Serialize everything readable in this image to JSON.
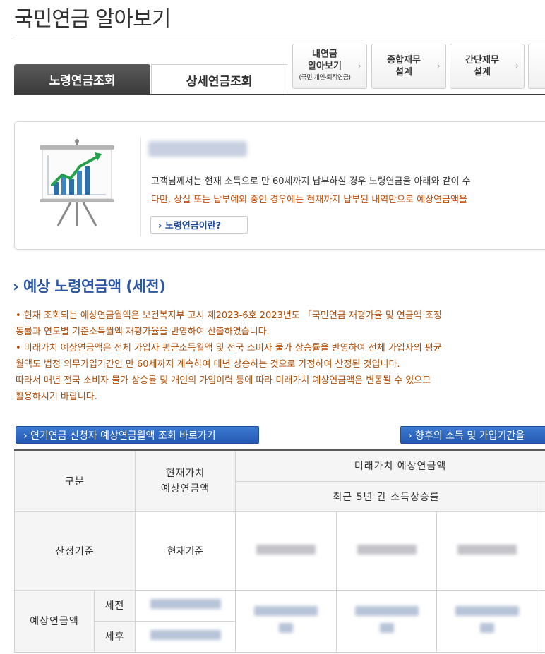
{
  "page": {
    "title": "국민연금 알아보기"
  },
  "tabs": [
    {
      "label": "노령연금조회",
      "active": true
    },
    {
      "label": "상세연금조회",
      "active": false
    }
  ],
  "quick_links": [
    {
      "line1": "내연금",
      "line2": "알아보기",
      "sub": "(국민·개인·퇴직연금)"
    },
    {
      "line1": "종합재무",
      "line2": "설계"
    },
    {
      "line1": "간단재무",
      "line2": "설계"
    }
  ],
  "intro": {
    "icon": "chart-presentation-icon",
    "text1": "고객님께서는 현재 소득으로 만 60세까지 납부하실 경우 노령연금을 아래와 같이 수",
    "text2": "다만, 상실 또는 납부예외 중인 경우에는 현재까지 납부된 내역만으로 예상연금액을",
    "button": "› 노령연금이란?"
  },
  "section": {
    "title": "› 예상 노령연금액 (세전)",
    "notes": [
      "• 현재 조회되는 예상연금월액은 보건복지부 고시 제2023-6호 2023년도 「국민연금 재평가율 및 연금액 조정",
      "  동률과 연도별 기준소득월액 재평가율을 반영하여 산출하였습니다.",
      "• 미래가치 예상연금액은 전체 가입자 평균소득월액 및 전국 소비자 물가 상승률을 반영하여 전체 가입자의 평균",
      "  월액도 법정 의무가입기간인 만 60세까지 계속하여 매년 상승하는 것으로 가정하여 산정된 것입니다.",
      "  따라서 매년 전국 소비자 물가 상승률 및 개인의 가입이력 등에 따라 미래가치 예상연금액은 변동될 수 있으므",
      "  활용하시기 바랍니다."
    ]
  },
  "buttons": {
    "left": "› 연기연금 신청자 예상연금월액 조회 바로가기",
    "right": "› 향후의 소득 및 가입기간을"
  },
  "table": {
    "h_category": "구분",
    "h_present": "현재가치\n예상연금액",
    "h_future": "미래가치 예상연금액",
    "h_future_sub": "최근 5년 간 소득상승률",
    "row_basis": "산정기준",
    "basis_present": "현재기준",
    "row_amount": "예상연금액",
    "pre_tax": "세전",
    "post_tax": "세후"
  }
}
